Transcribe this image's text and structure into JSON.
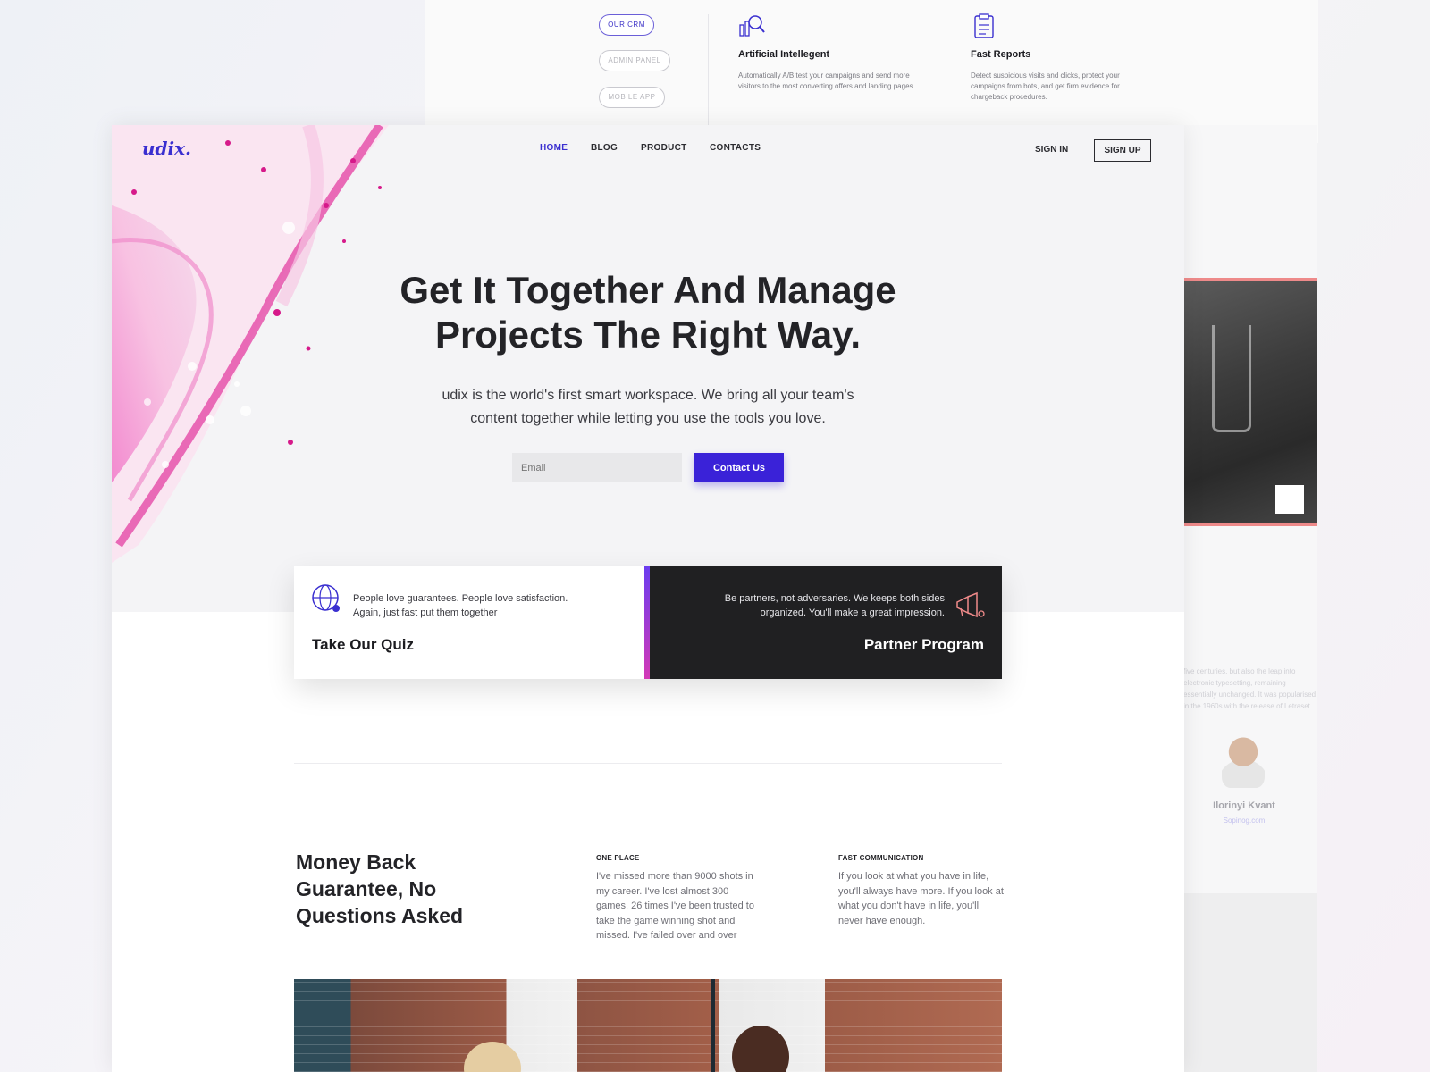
{
  "back_panel": {
    "pills": [
      "OUR CRM",
      "ADMIN PANEL",
      "MOBILE APP"
    ],
    "features": [
      {
        "icon": "analytics-search-icon",
        "title": "Artificial Intellegent",
        "text": "Automatically A/B test your campaigns and send more visitors to the most converting offers and landing pages"
      },
      {
        "icon": "clipboard-report-icon",
        "title": "Fast Reports",
        "text": "Detect suspicious visits and clicks, protect your campaigns from bots, and get firm evidence for chargeback procedures."
      }
    ]
  },
  "side_panel": {
    "text": "five centuries, but also the leap into electronic typesetting, remaining essentially unchanged. It was popularised in the 1960s with the release of Letraset sheets containing Lorem Ipsum passages, and more recently with desktop publishing software like Aldus PageMaker including versions",
    "person_name": "Ilorinyi Kvant",
    "person_site": "Sopinog.com"
  },
  "header": {
    "logo": "udix.",
    "nav": [
      "HOME",
      "BLOG",
      "PRODUCT",
      "CONTACTS"
    ],
    "active_nav": "HOME",
    "sign_in": "SIGN IN",
    "sign_up": "SIGN UP"
  },
  "hero": {
    "title_line1": "Get It Together And Manage",
    "title_line2": "Projects The Right Way.",
    "subtitle_line1": "udix is the world's first smart workspace. We bring all your team's",
    "subtitle_line2": "content together while letting you use the tools you love.",
    "email_placeholder": "Email",
    "cta": "Contact Us"
  },
  "cards": {
    "left": {
      "icon": "globe-quiz-icon",
      "text_line1": "People love guarantees. People love satisfaction.",
      "text_line2": "Again, just fast put them together",
      "title": "Take Our Quiz"
    },
    "right": {
      "icon": "megaphone-icon",
      "text_line1": "Be partners, not adversaries. We keeps both sides",
      "text_line2": "organized. You'll make a great impression.",
      "title": "Partner Program"
    }
  },
  "guarantee": {
    "title_line1": "Money Back",
    "title_line2": "Guarantee, No",
    "title_line3": "Questions Asked",
    "columns": [
      {
        "heading": "ONE PLACE",
        "text": "I've missed more than 9000 shots in my career. I've lost almost 300 games. 26 times I've been trusted to take the game winning shot and missed. I've failed over and over"
      },
      {
        "heading": "FAST COMMUNICATION",
        "text": "If you look at what you have in life, you'll always have more. If you look at what you don't have in life, you'll never have enough."
      }
    ]
  },
  "colors": {
    "accent": "#3a22d8",
    "dark_card": "#202022",
    "photo_border": "#ee8a8a"
  }
}
